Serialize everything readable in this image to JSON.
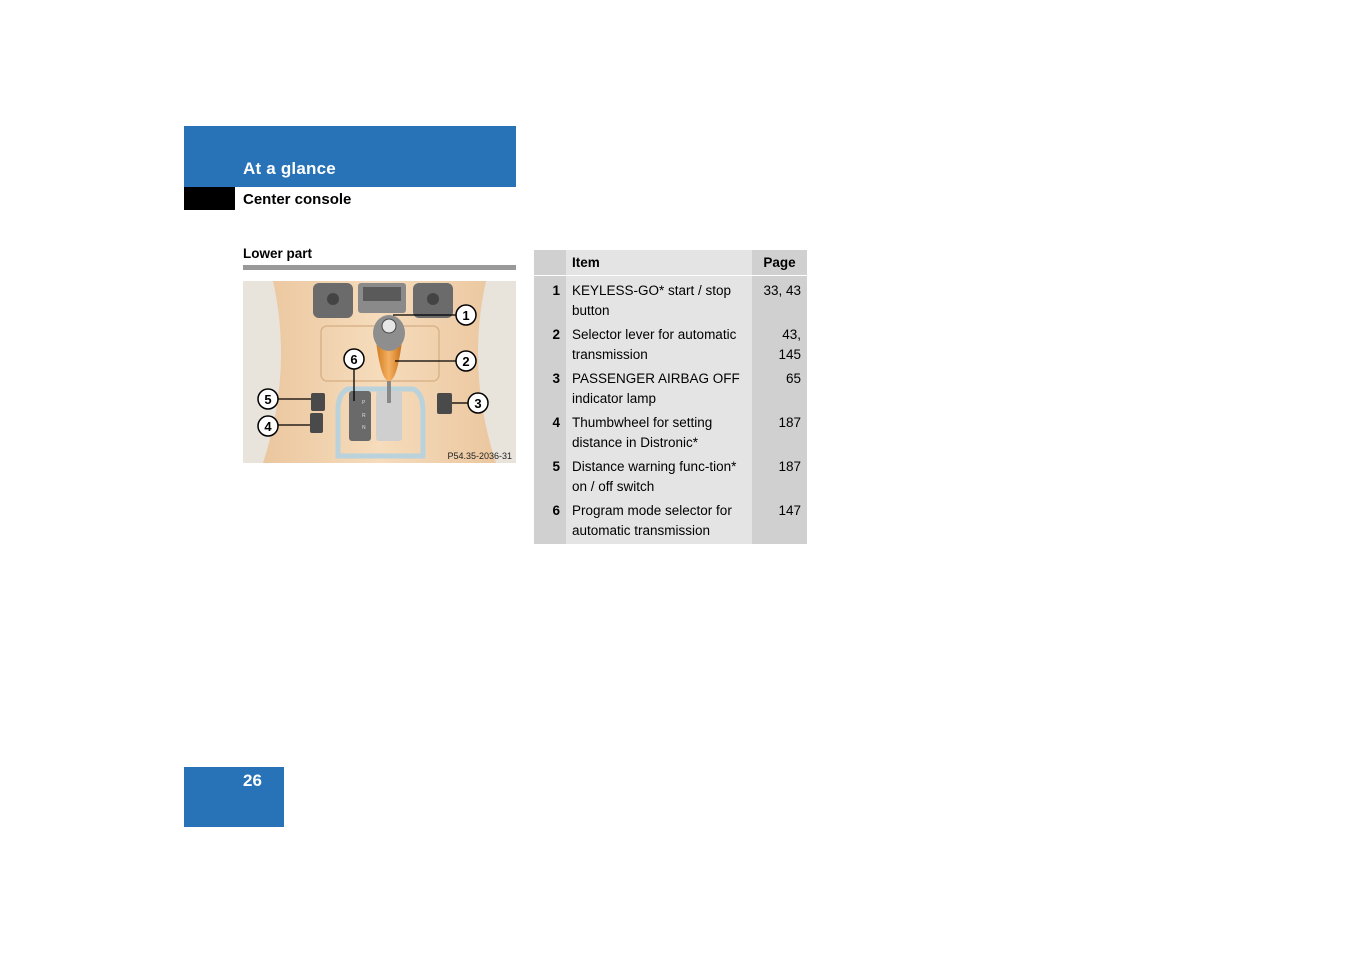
{
  "header": {
    "section_title": "At a glance",
    "subtitle": "Center console"
  },
  "section": {
    "heading": "Lower part"
  },
  "figure": {
    "code": "P54.35-2036-31",
    "callouts": [
      "1",
      "2",
      "3",
      "4",
      "5",
      "6"
    ],
    "shifter_letters": [
      "P",
      "R",
      "N"
    ]
  },
  "table": {
    "columns": [
      "",
      "Item",
      "Page"
    ],
    "rows": [
      {
        "num": "1",
        "item": "KEYLESS-GO* start / stop button",
        "page": "33, 43"
      },
      {
        "num": "2",
        "item": "Selector lever for automatic transmission",
        "page": "43, 145"
      },
      {
        "num": "3",
        "item": "PASSENGER AIRBAG OFF indicator lamp",
        "page": "65"
      },
      {
        "num": "4",
        "item": "Thumbwheel for setting distance in Distronic*",
        "page": "187"
      },
      {
        "num": "5",
        "item": "Distance warning func-tion* on / off switch",
        "page": "187"
      },
      {
        "num": "6",
        "item": "Program mode selector for automatic transmission",
        "page": "147"
      }
    ]
  },
  "footer": {
    "page_number": "26"
  },
  "colors": {
    "brand_blue": "#2872b8",
    "table_dark": "#d0d0d0",
    "table_light": "#e4e4e4",
    "rule_gray": "#999999"
  }
}
